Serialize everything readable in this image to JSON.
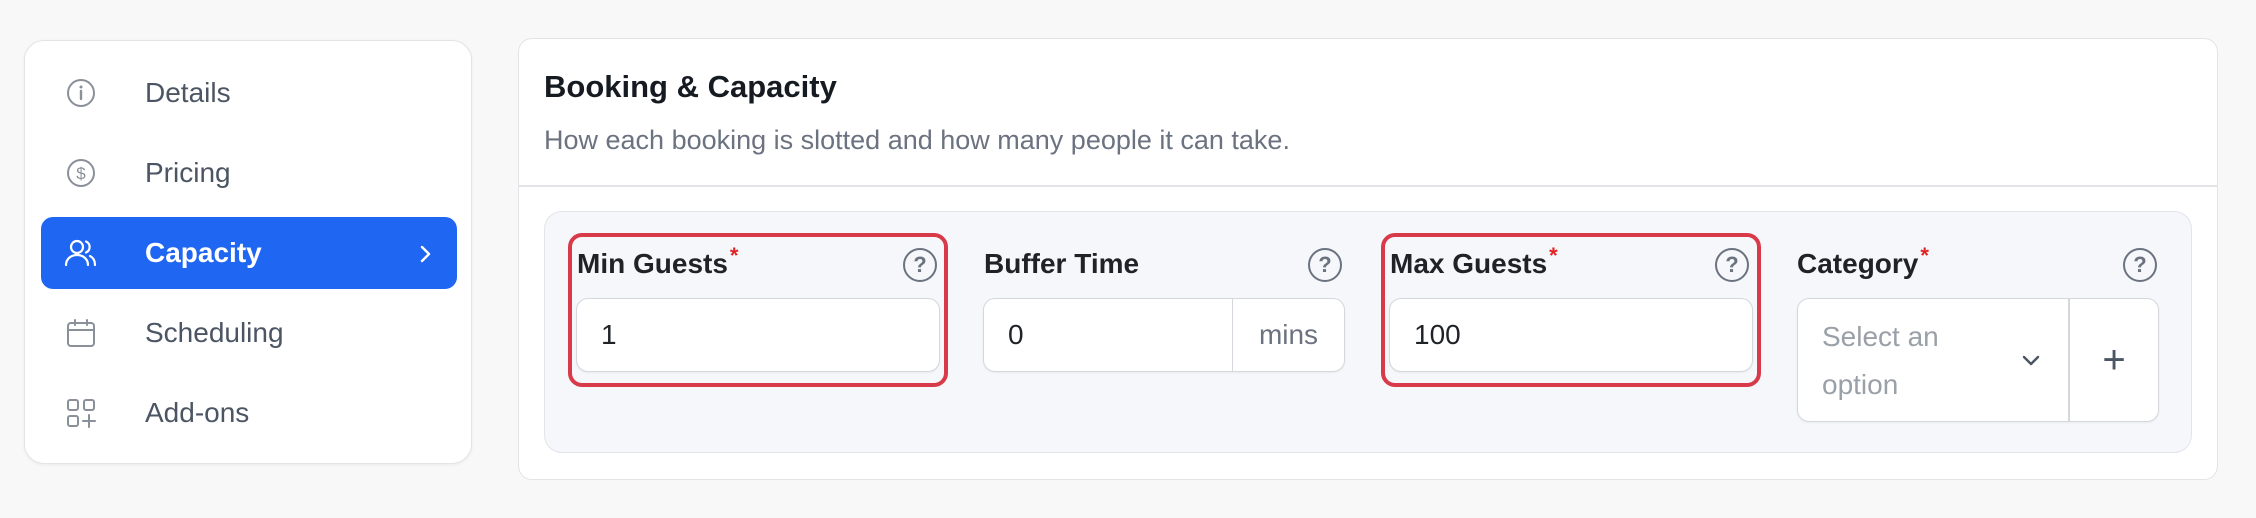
{
  "sidebar": {
    "items": [
      {
        "label": "Details",
        "icon": "info-icon",
        "active": false
      },
      {
        "label": "Pricing",
        "icon": "dollar-icon",
        "active": false
      },
      {
        "label": "Capacity",
        "icon": "users-icon",
        "active": true
      },
      {
        "label": "Scheduling",
        "icon": "calendar-icon",
        "active": false
      },
      {
        "label": "Add-ons",
        "icon": "add-ons-icon",
        "active": false
      }
    ]
  },
  "card": {
    "title": "Booking & Capacity",
    "subtitle": "How each booking is slotted and how many people it can take."
  },
  "fields": {
    "min_guests": {
      "label": "Min Guests",
      "required": "*",
      "value": "1"
    },
    "buffer_time": {
      "label": "Buffer Time",
      "value": "0",
      "suffix": "mins"
    },
    "max_guests": {
      "label": "Max Guests",
      "required": "*",
      "value": "100"
    },
    "category": {
      "label": "Category",
      "required": "*",
      "placeholder": "Select an option",
      "add": "+"
    }
  },
  "help_glyph": "?",
  "colors": {
    "accent": "#1f66f2",
    "highlight": "#d93a4a",
    "required": "#e02424"
  }
}
